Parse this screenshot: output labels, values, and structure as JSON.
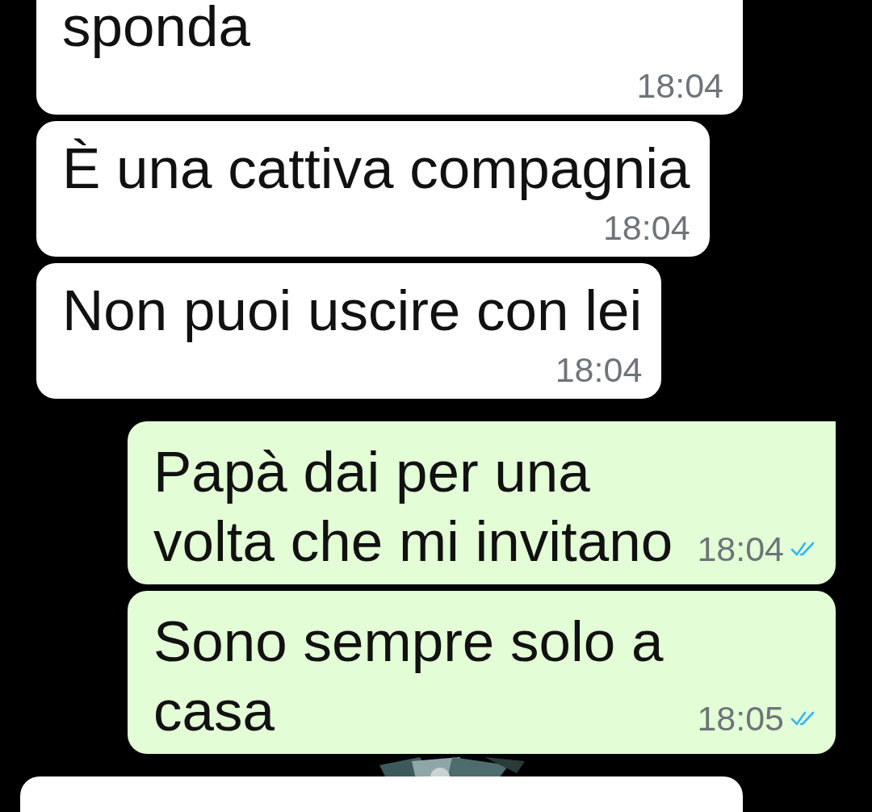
{
  "messages": [
    {
      "kind": "incoming",
      "text": "sponda",
      "time": "18:04",
      "cut": true
    },
    {
      "kind": "incoming",
      "text": "È una cattiva compagnia",
      "time": "18:04",
      "cut": false
    },
    {
      "kind": "incoming",
      "text": "Non puoi uscire con lei",
      "time": "18:04",
      "cut": false
    },
    {
      "kind": "outgoing",
      "text": "Papà dai per una volta che mi invitano",
      "time": "18:04",
      "read": true,
      "tail": true
    },
    {
      "kind": "outgoing",
      "text": "Sono sempre solo a casa",
      "time": "18:05",
      "read": true,
      "tail": false
    }
  ]
}
